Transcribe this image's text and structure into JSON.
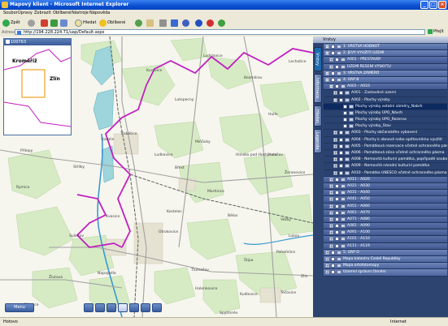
{
  "window": {
    "title": "Mapový klient - Microsoft Internet Explorer"
  },
  "menu": [
    "Soubor",
    "Úpravy",
    "Zobrazit",
    "Oblíbené",
    "Nástroje",
    "Nápověda"
  ],
  "toolbar": {
    "back": "Zpět",
    "search": "Hledat",
    "favorites": "Oblíbené"
  },
  "address": {
    "label": "Adresa",
    "url": "http://194.228.224.71/uap/Default.aspx",
    "go": "Přejít"
  },
  "overview": {
    "title": "100763",
    "cities": [
      "Kroměříž",
      "Zlín"
    ]
  },
  "map": {
    "towns": [
      "Ludslavice",
      "Lechotice",
      "Kurovice",
      "Bezměrov",
      "Lutopecny",
      "Hulín",
      "Třebětice",
      "Karolín",
      "Miňůvky",
      "Ludkovice",
      "Hlinsko pod Hostýnem",
      "Holešov",
      "Břest",
      "Žeranovice",
      "Třebětice",
      "Střílky",
      "Přílepy",
      "Rymice",
      "Martinice",
      "Věžky",
      "Kostelec",
      "Kvasice",
      "Bělov",
      "Sulimov",
      "Otrokovice",
      "Tlumačov",
      "Napajedla",
      "Žlutava",
      "Halenkovice",
      "Kudlovice",
      "Bílovice",
      "Spytihněv",
      "Tečovice",
      "Pohořelice",
      "Štípa",
      "Lukov",
      "Zlín"
    ],
    "map_button": "Menu"
  },
  "panel": {
    "title": "Vrstvy",
    "tabs": [
      "Vrstvy",
      "Informace",
      "Hledat",
      "Legenda"
    ],
    "rows": [
      {
        "level": 0,
        "pm": "−",
        "label": "1. VRSTVA HODNOT"
      },
      {
        "level": 0,
        "pm": "−",
        "label": "2. JEVY VYUŽITÍ ÚZEMÍ"
      },
      {
        "level": 1,
        "pm": "+",
        "label": "A001 - PŘESTAVBY"
      },
      {
        "level": 1,
        "pm": "+",
        "label": "ÚZEMÍ ŘEŠENÍ VÝSKYTU"
      },
      {
        "level": 0,
        "pm": "−",
        "label": "3. VRSTVA ZÁMĚRŮ"
      },
      {
        "level": 0,
        "pm": "−",
        "label": "4. ÚAP B"
      },
      {
        "level": 1,
        "pm": "−",
        "label": "A001 - A010"
      },
      {
        "level": 2,
        "pm": "+",
        "label": "A001 - Zastavěné území"
      },
      {
        "level": 2,
        "pm": "−",
        "label": "A002 - Plochy výroby"
      },
      {
        "level": 3,
        "pm": "",
        "label": "Plochy výroby ostatní záměry_Nabrh",
        "sel": true
      },
      {
        "level": 3,
        "pm": "",
        "label": "Plochy výroby ÚPO_Návrh"
      },
      {
        "level": 3,
        "pm": "",
        "label": "Plochy výroby ÚPO_Rezerva"
      },
      {
        "level": 3,
        "pm": "",
        "label": "Plochy výroby_Stav"
      },
      {
        "level": 2,
        "pm": "+",
        "label": "A003 - Plochy občanského vybavení"
      },
      {
        "level": 2,
        "pm": "+",
        "label": "A004 - Plochy k obnově nebo opětovnému využití"
      },
      {
        "level": 2,
        "pm": "+",
        "label": "A005 - Památková rezervace včetně ochranného pásma"
      },
      {
        "level": 2,
        "pm": "+",
        "label": "A006 - Památková zóna včetně ochranného pásma"
      },
      {
        "level": 2,
        "pm": "+",
        "label": "A008 - Nemovitá kulturní památka, popřípadě soubor"
      },
      {
        "level": 2,
        "pm": "+",
        "label": "A009 - Nemovitá národní kulturní památka"
      },
      {
        "level": 2,
        "pm": "+",
        "label": "A010 - Památka UNESCO včetně ochranného pásma"
      },
      {
        "level": 1,
        "pm": "+",
        "label": "A011 - A020"
      },
      {
        "level": 1,
        "pm": "+",
        "label": "A021 - A030"
      },
      {
        "level": 1,
        "pm": "+",
        "label": "A031 - A040"
      },
      {
        "level": 1,
        "pm": "+",
        "label": "A041 - A050"
      },
      {
        "level": 1,
        "pm": "+",
        "label": "A051 - A060"
      },
      {
        "level": 1,
        "pm": "+",
        "label": "A061 - A070"
      },
      {
        "level": 1,
        "pm": "+",
        "label": "A071 - A080"
      },
      {
        "level": 1,
        "pm": "+",
        "label": "A081 - A090"
      },
      {
        "level": 1,
        "pm": "+",
        "label": "A091 - A100"
      },
      {
        "level": 1,
        "pm": "+",
        "label": "A101 - A110"
      },
      {
        "level": 1,
        "pm": "+",
        "label": "A111 - A119"
      },
      {
        "level": 0,
        "pm": "+",
        "label": "5. ÚAP O"
      },
      {
        "level": 0,
        "pm": "+",
        "label": "Mapa katastru České Republiky"
      },
      {
        "level": 0,
        "pm": "+",
        "label": "Mapa ortofotomapy"
      },
      {
        "level": 0,
        "pm": "+",
        "label": "Územní správní členění"
      }
    ]
  },
  "status": {
    "left": "Hotovo",
    "right": "Internet"
  }
}
